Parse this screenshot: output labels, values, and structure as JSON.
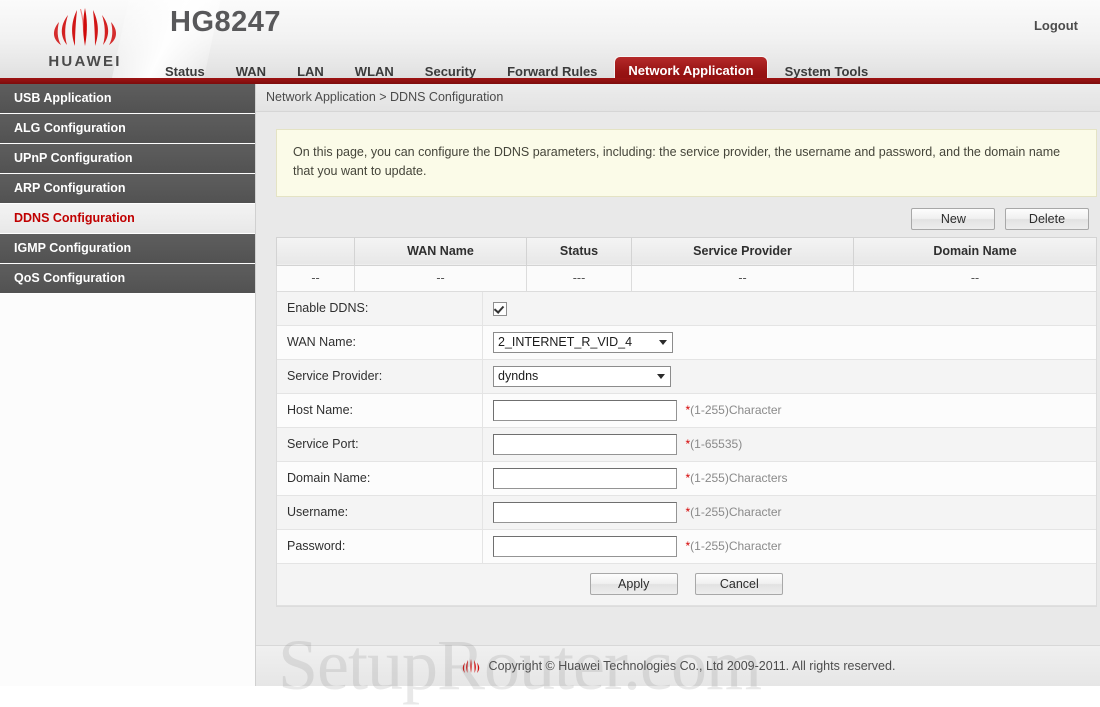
{
  "header": {
    "brand": "HUAWEI",
    "model": "HG8247",
    "logout_label": "Logout",
    "logo_icon": "huawei-logo-icon",
    "accent_red": "#9e1414",
    "active_tab_red": "#991414"
  },
  "nav": {
    "tabs": [
      {
        "label": "Status",
        "active": false
      },
      {
        "label": "WAN",
        "active": false
      },
      {
        "label": "LAN",
        "active": false
      },
      {
        "label": "WLAN",
        "active": false
      },
      {
        "label": "Security",
        "active": false
      },
      {
        "label": "Forward Rules",
        "active": false
      },
      {
        "label": "Network Application",
        "active": true
      },
      {
        "label": "System Tools",
        "active": false
      }
    ]
  },
  "sidebar": {
    "items": [
      {
        "label": "USB Application",
        "active": false
      },
      {
        "label": "ALG Configuration",
        "active": false
      },
      {
        "label": "UPnP Configuration",
        "active": false
      },
      {
        "label": "ARP Configuration",
        "active": false
      },
      {
        "label": "DDNS Configuration",
        "active": true
      },
      {
        "label": "IGMP Configuration",
        "active": false
      },
      {
        "label": "QoS Configuration",
        "active": false
      }
    ]
  },
  "breadcrumb": "Network Application > DDNS Configuration",
  "infobox": "On this page, you can configure the DDNS parameters, including: the service provider, the username and password, and the domain name that you want to update.",
  "toolbar": {
    "new_label": "New",
    "delete_label": "Delete"
  },
  "table": {
    "columns": [
      "",
      "WAN Name",
      "Status",
      "Service Provider",
      "Domain Name"
    ],
    "rows": [
      [
        "--",
        "--",
        "---",
        "--",
        "--"
      ]
    ]
  },
  "form": {
    "enable_ddns": {
      "label": "Enable DDNS:",
      "checked": true
    },
    "wan_name": {
      "label": "WAN Name:",
      "value": "2_INTERNET_R_VID_4"
    },
    "service_provider": {
      "label": "Service Provider:",
      "value": "dyndns"
    },
    "host_name": {
      "label": "Host Name:",
      "value": "",
      "hint_star": "*",
      "hint": "(1-255)Character"
    },
    "service_port": {
      "label": "Service Port:",
      "value": "",
      "hint_star": "*",
      "hint": "(1-65535)"
    },
    "domain_name": {
      "label": "Domain Name:",
      "value": "",
      "hint_star": "*",
      "hint": "(1-255)Characters"
    },
    "username": {
      "label": "Username:",
      "value": "",
      "hint_star": "*",
      "hint": "(1-255)Character"
    },
    "password": {
      "label": "Password:",
      "value": "",
      "hint_star": "*",
      "hint": "(1-255)Character"
    },
    "apply_label": "Apply",
    "cancel_label": "Cancel"
  },
  "footer": {
    "copyright": "Copyright © Huawei Technologies Co., Ltd 2009-2011. All rights reserved.",
    "logo_icon": "huawei-logo-icon"
  },
  "watermark": "SetupRouter.com"
}
